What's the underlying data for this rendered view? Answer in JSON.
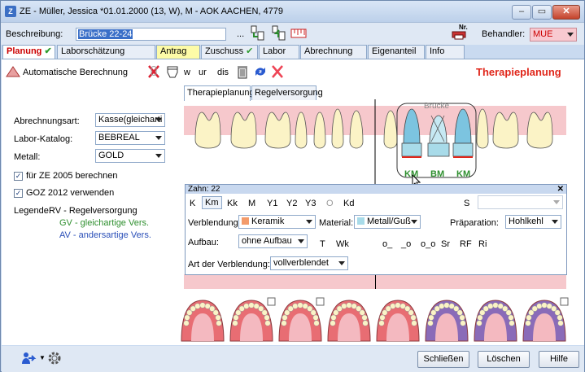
{
  "window": {
    "title": "ZE - Müller, Jessica  *01.01.2000 (13, W),  M - AOK AACHEN,  4779",
    "min": "–",
    "max": "▭",
    "close": "✕"
  },
  "header": {
    "beschreibung_label": "Beschreibung:",
    "beschreibung_value": "Brücke 22-24",
    "ellipsis": "...",
    "nr_label": "Nr.",
    "behandler_label": "Behandler:",
    "behandler_value": "MUE"
  },
  "tabs": [
    {
      "label": "Planung"
    },
    {
      "label": "Laborschätzung"
    },
    {
      "label": "Antrag"
    },
    {
      "label": "Zuschuss"
    },
    {
      "label": "Labor"
    },
    {
      "label": "Abrechnung"
    },
    {
      "label": "Eigenanteil"
    },
    {
      "label": "Info"
    }
  ],
  "toolbar": {
    "auto_calc": "Automatische Berechnung",
    "w": "w",
    "ur": "ur",
    "dis": "dis",
    "heading": "Therapieplanung"
  },
  "subtabs": [
    "Therapieplanung",
    "Regelversorgung"
  ],
  "left": {
    "abrechnungsart_label": "Abrechnungsart:",
    "abrechnungsart_value": "Kasse(gleicharti",
    "labor_label": "Labor-Katalog:",
    "labor_value": "BEBREAL",
    "metall_label": "Metall:",
    "metall_value": "GOLD",
    "cb1": "für ZE 2005 berechnen",
    "cb2": "GOZ 2012 verwenden",
    "legend_label": "Legende:",
    "legend_rv": "RV - Regelversorgung",
    "legend_gv": "GV - gleichartige Vers.",
    "legend_av": "AV - andersartige Vers."
  },
  "chart": {
    "bruecke": "Brücke",
    "codes": [
      "KM",
      "BM",
      "KM"
    ]
  },
  "popup": {
    "title": "Zahn: 22",
    "close": "✕",
    "keys": [
      "K",
      "Km",
      "Kk",
      "M",
      "Y1",
      "Y2",
      "Y3",
      "O",
      "Kd"
    ],
    "s_label": "S",
    "verblendung_label": "Verblendung:",
    "verblendung_value": "Keramik",
    "material_label": "Material:",
    "material_value": "Metall/Guß",
    "praep_label": "Präparation:",
    "praep_value": "Hohlkehl",
    "aufbau_label": "Aufbau:",
    "aufbau_value": "ohne Aufbau",
    "row3": [
      "T",
      "Wk",
      "o_",
      "_o",
      "o_o",
      "Sr",
      "RF",
      "Ri"
    ],
    "art_label": "Art der Verblendung:",
    "art_value": "vollverblendet"
  },
  "bottom": {
    "schliessen": "Schließen",
    "loeschen": "Löschen",
    "hilfe": "Hilfe"
  },
  "colors": {
    "pink_band": "#f6c8cc",
    "tooth": "#fbf3c6",
    "bridge_blue": "#a8dbe9",
    "accent_red": "#e0271b",
    "gv_green": "#2e8f2e",
    "av_blue": "#2a4fb8"
  }
}
